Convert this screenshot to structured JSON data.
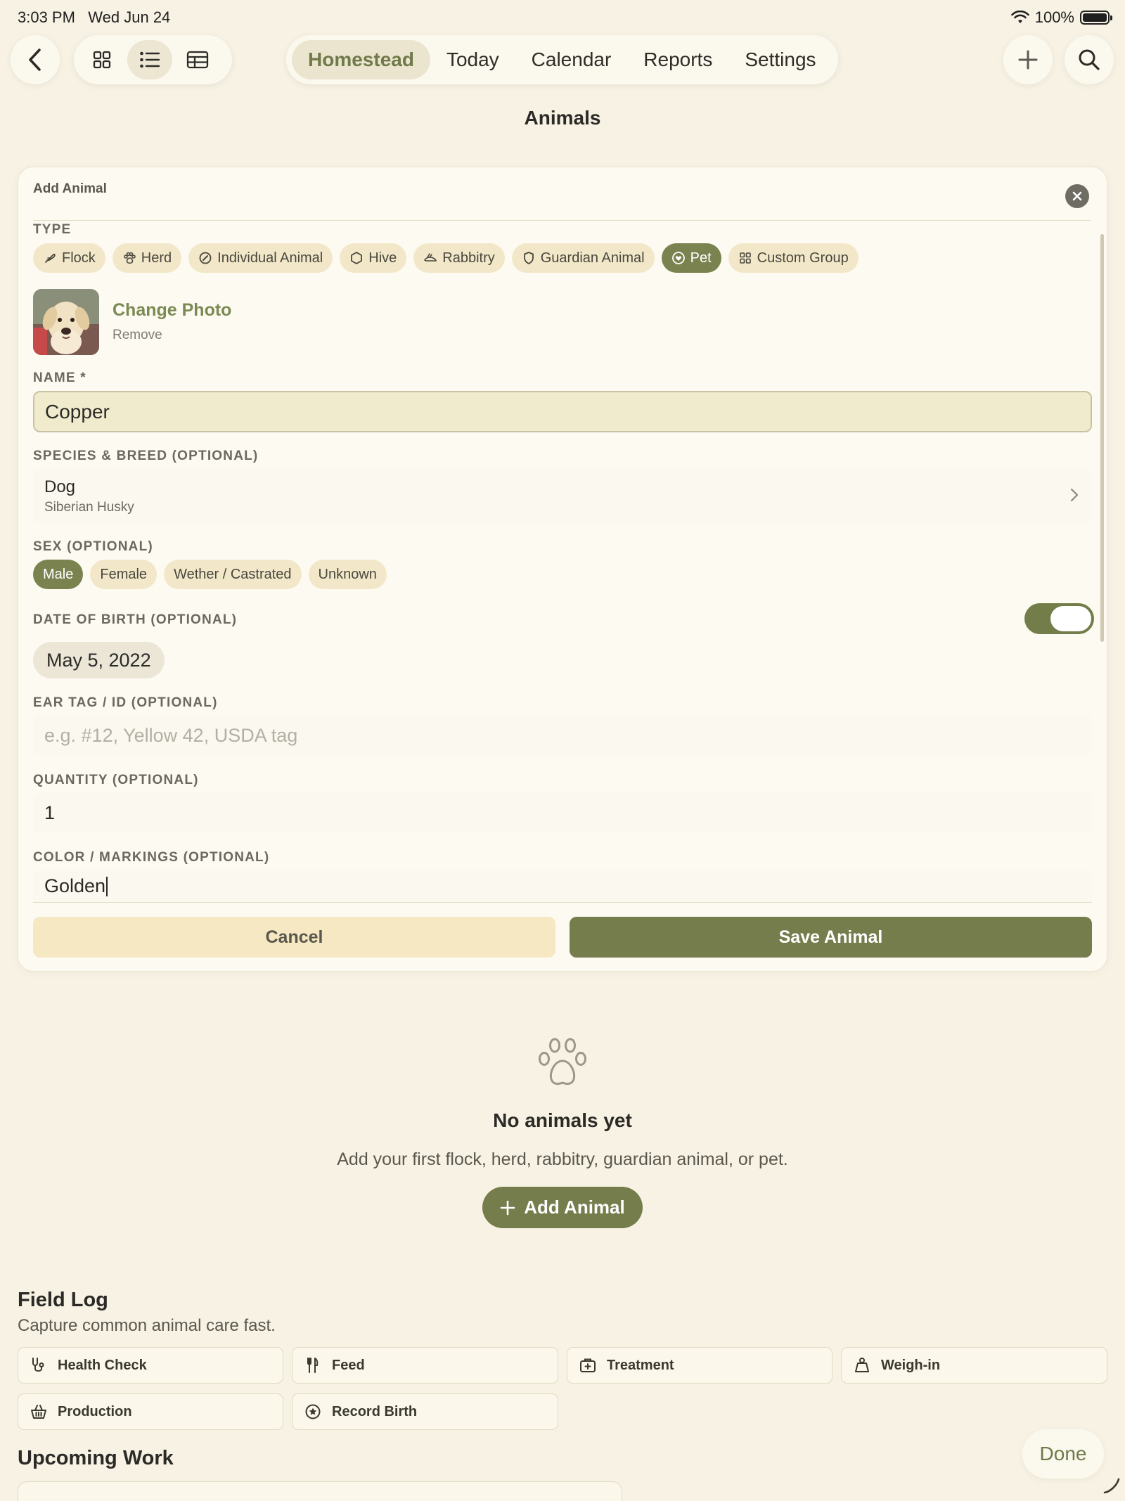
{
  "status_bar": {
    "time": "3:03 PM",
    "date": "Wed Jun 24",
    "battery": "100%"
  },
  "nav": {
    "tabs": [
      "Homestead",
      "Today",
      "Calendar",
      "Reports",
      "Settings"
    ],
    "active_tab": "Homestead"
  },
  "page": {
    "title": "Animals"
  },
  "form": {
    "header": "Add Animal",
    "type_label": "TYPE",
    "types": [
      {
        "label": "Flock",
        "icon": "feather-icon"
      },
      {
        "label": "Herd",
        "icon": "paw-icon"
      },
      {
        "label": "Individual Animal",
        "icon": "target-icon"
      },
      {
        "label": "Hive",
        "icon": "hexagon-icon"
      },
      {
        "label": "Rabbitry",
        "icon": "rabbit-icon"
      },
      {
        "label": "Guardian Animal",
        "icon": "shield-icon"
      },
      {
        "label": "Pet",
        "icon": "heart-icon"
      },
      {
        "label": "Custom Group",
        "icon": "grid-icon"
      }
    ],
    "selected_type": "Pet",
    "photo": {
      "change_label": "Change Photo",
      "remove_label": "Remove"
    },
    "name_label": "NAME *",
    "name_value": "Copper",
    "species_label": "SPECIES & BREED (OPTIONAL)",
    "species_value": "Dog",
    "breed_value": "Siberian Husky",
    "sex_label": "SEX (OPTIONAL)",
    "sex_options": [
      "Male",
      "Female",
      "Wether / Castrated",
      "Unknown"
    ],
    "selected_sex": "Male",
    "dob_label": "DATE OF BIRTH (OPTIONAL)",
    "dob_enabled": true,
    "dob_value": "May 5, 2022",
    "ear_tag_label": "EAR TAG / ID (OPTIONAL)",
    "ear_tag_placeholder": "e.g. #12, Yellow 42, USDA tag",
    "quantity_label": "QUANTITY (OPTIONAL)",
    "quantity_value": "1",
    "color_label": "COLOR / MARKINGS (OPTIONAL)",
    "color_value": "Golden",
    "cancel_label": "Cancel",
    "save_label": "Save Animal"
  },
  "empty_state": {
    "title": "No animals yet",
    "subtitle": "Add your first flock, herd, rabbitry, guardian animal, or pet.",
    "add_label": "Add Animal"
  },
  "field_log": {
    "title": "Field Log",
    "subtitle": "Capture common animal care fast.",
    "actions": [
      {
        "label": "Health Check",
        "icon": "stethoscope-icon"
      },
      {
        "label": "Feed",
        "icon": "fork-knife-icon"
      },
      {
        "label": "Treatment",
        "icon": "medical-kit-icon"
      },
      {
        "label": "Weigh-in",
        "icon": "weight-icon"
      },
      {
        "label": "Production",
        "icon": "basket-icon"
      },
      {
        "label": "Record Birth",
        "icon": "star-circle-icon"
      }
    ]
  },
  "upcoming": {
    "title": "Upcoming Work"
  },
  "keyboard_toolbar": {
    "done_label": "Done"
  },
  "colors": {
    "accent": "#757d4c",
    "background": "#f7f2e3",
    "chip": "#f2e8c9"
  }
}
